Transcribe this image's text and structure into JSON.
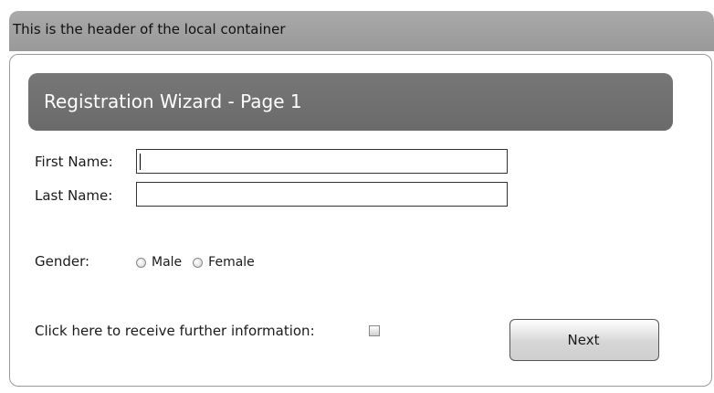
{
  "outer_header": {
    "text": "This is the header of the local container"
  },
  "wizard": {
    "title": "Registration Wizard - Page 1"
  },
  "form": {
    "first_name": {
      "label": "First Name:",
      "value": ""
    },
    "last_name": {
      "label": "Last Name:",
      "value": ""
    },
    "gender": {
      "label": "Gender:",
      "options": [
        "Male",
        "Female"
      ]
    },
    "info_checkbox": {
      "label": "Click here to receive further information:",
      "checked": false
    },
    "next_label": "Next"
  },
  "colors": {
    "outer_header_bg": "#a3a3a3",
    "wizard_header_bg": "#717171",
    "wizard_title_text": "#ffffff",
    "container_border": "#9a9a9a"
  }
}
